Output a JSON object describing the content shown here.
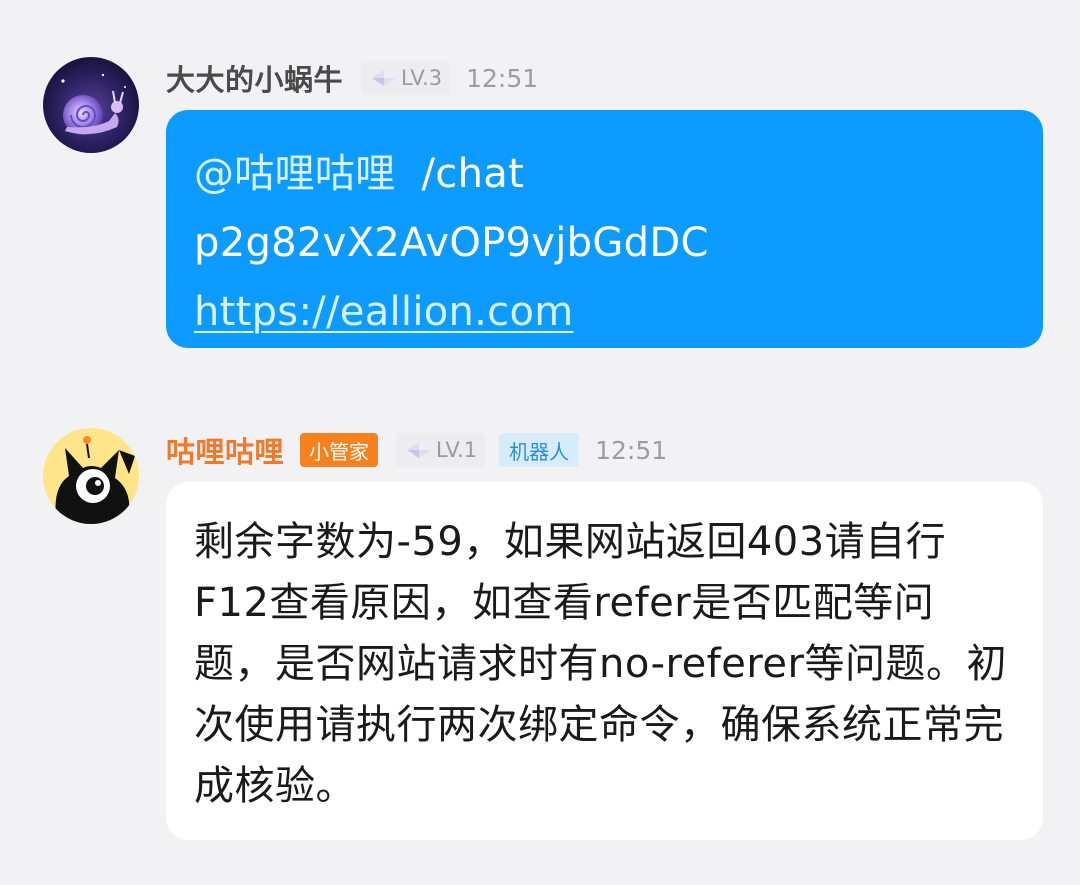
{
  "messages": [
    {
      "sender": "大大的小蜗牛",
      "level": "LV.3",
      "time": "12:51",
      "avatar_icon": "snail-avatar-icon",
      "bubble_color": "#0d9bff",
      "mention": "@咕哩咕哩",
      "command": "/chat",
      "token": "p2g82vX2AvOP9vjbGdDC",
      "link": "https://eallion.com"
    },
    {
      "sender": "咕哩咕哩",
      "role_badge": "小管家",
      "level": "LV.1",
      "bot_badge": "机器人",
      "time": "12:51",
      "avatar_icon": "black-cat-avatar-icon",
      "name_color": "#f07a2a",
      "text": "剩余字数为-59，如果网站返回403请自行F12查看原因，如查看refer是否匹配等问题，是否网站请求时有no-referer等问题。初次使用请执行两次绑定命令，确保系统正常完成核验。"
    }
  ]
}
